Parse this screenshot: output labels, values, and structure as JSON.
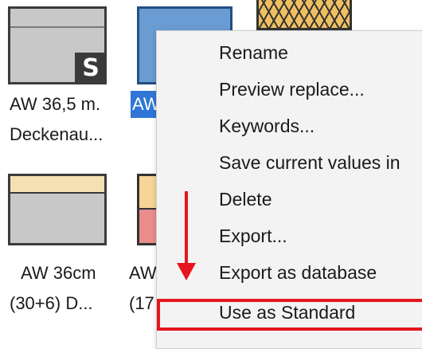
{
  "items": [
    {
      "line1": "AW 36,5 m.",
      "line2": "Deckenau..."
    },
    {
      "line1": "AW",
      "line2": ""
    },
    {
      "line1": "AW 36cm",
      "line2": "(30+6) D..."
    },
    {
      "line1": "AW",
      "line2": "(17"
    }
  ],
  "badge": "S",
  "context_menu": {
    "items": [
      "Rename",
      "Preview replace...",
      "Keywords...",
      "Save current values in",
      "Delete",
      "Export...",
      "Export as database",
      "Use as Standard"
    ],
    "highlighted_item": "Use as Standard"
  },
  "annotation": {
    "color": "#e5161d"
  },
  "colors": {
    "selection": "#2f76d6",
    "menu_bg": "#f3f3f3"
  }
}
